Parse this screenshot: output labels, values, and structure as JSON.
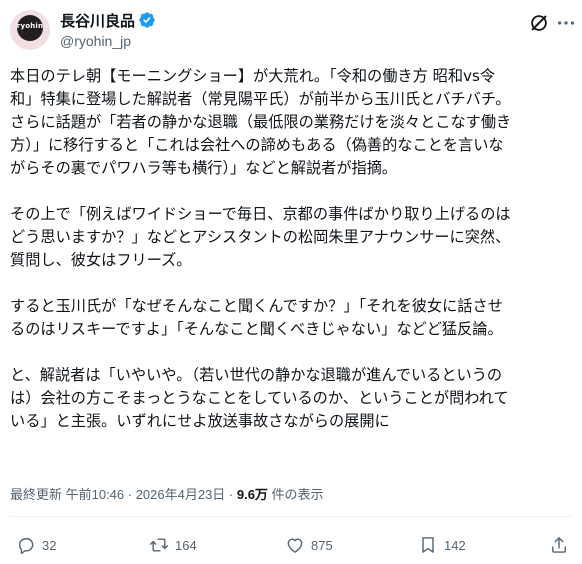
{
  "author": {
    "avatar_text": "ryohin",
    "display_name": "長谷川良品",
    "handle": "@ryohin_jp",
    "verified_color": "#1d9bf0"
  },
  "icons": {
    "verified": "verified-badge-icon",
    "grok": "grok-icon",
    "more": "more-icon",
    "reply": "reply-icon",
    "repost": "repost-icon",
    "like": "like-icon",
    "bookmark": "bookmark-icon",
    "share": "share-icon"
  },
  "tweet": {
    "paragraphs": [
      "本日のテレ朝【モーニングショー】が大荒れ。「令和の働き方 昭和vs令\n和」特集に登場した解説者（常見陽平氏）が前半から玉川氏とバチバチ。\nさらに話題が「若者の静かな退職（最低限の業務だけを淡々とこなす働き\n方）」に移行すると「これは会社への諦めもある（偽善的なことを言いな\nがらその裏でパワハラ等も横行）」などと解説者が指摘。",
      "その上で「例えばワイドショーで毎日、京都の事件ばかり取り上げるのは\nどう思いますか？」などとアシスタントの松岡朱里アナウンサーに突然、\n質問し、彼女はフリーズ。",
      "すると玉川氏が「なぜそんなこと聞くんですか？」「それを彼女に話させ\nるのはリスキーですよ」「そんなこと聞くべきじゃない」などど猛反論。",
      "と、解説者は「いやいや。（若い世代の静かな退職が進んでいるというの\nは）会社の方こそまっとうなことをしているのか、ということが問われて\nいる」と主張。いずれにせよ放送事故さながらの展開に"
    ]
  },
  "meta": {
    "prefix": "最終更新 午前10:46 · 2026年4月23日 · ",
    "views": "9.6万",
    "views_suffix": " 件の表示"
  },
  "actions": {
    "reply_count": "32",
    "repost_count": "164",
    "like_count": "875",
    "bookmark_count": "142"
  }
}
